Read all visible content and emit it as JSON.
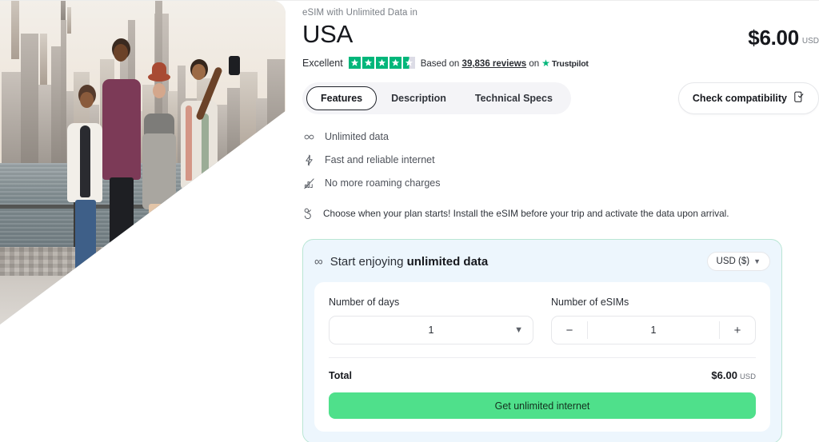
{
  "product": {
    "eyebrow": "eSIM with Unlimited Data in",
    "title": "USA",
    "price": "$6.00",
    "price_currency": "USD"
  },
  "trustpilot": {
    "rating_word": "Excellent",
    "stars_filled": 4,
    "stars_total": 5,
    "has_half": true,
    "based_on_prefix": "Based on",
    "reviews_count": "39,836 reviews",
    "on_text": "on",
    "brand": "Trustpilot",
    "star_color": "#00b67a"
  },
  "tabs": [
    {
      "label": "Features",
      "active": true
    },
    {
      "label": "Description",
      "active": false
    },
    {
      "label": "Technical Specs",
      "active": false
    }
  ],
  "compatibility": {
    "label": "Check compatibility",
    "icon": "phone-check-icon"
  },
  "features": [
    {
      "icon": "infinity-icon",
      "label": "Unlimited data"
    },
    {
      "icon": "lightning-bolt-icon",
      "label": "Fast and reliable internet"
    },
    {
      "icon": "no-roaming-icon",
      "label": "No more roaming charges"
    }
  ],
  "note": {
    "icon": "tap-gesture-icon",
    "text": "Choose when your plan starts! Install the eSIM before your trip and activate the data upon arrival."
  },
  "panel": {
    "icon": "infinity-icon",
    "title_prefix": "Start enjoying ",
    "title_strong": "unlimited data",
    "currency_selector": "USD ($)",
    "days": {
      "label": "Number of days",
      "value": "1"
    },
    "esims": {
      "label": "Number of eSIMs",
      "value": "1",
      "decrement": "−",
      "increment": "+"
    },
    "total": {
      "label": "Total",
      "value": "$6.00",
      "currency": "USD"
    },
    "cta_label": "Get unlimited internet",
    "accent_color": "#4fe08b",
    "background_color": "#edf6fd",
    "border_color": "#b9e6d4"
  }
}
